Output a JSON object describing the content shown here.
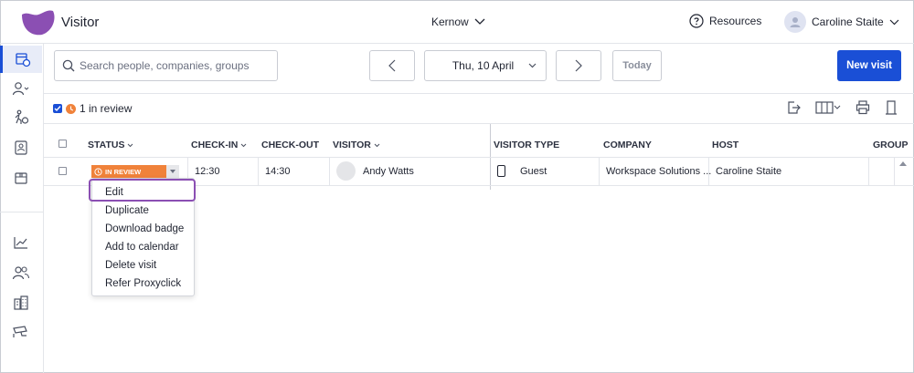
{
  "header": {
    "app_title": "Visitor",
    "location": "Kernow",
    "resources": "Resources",
    "user_name": "Caroline Staite"
  },
  "toolbar": {
    "search_placeholder": "Search people, companies, groups",
    "date": "Thu, 10 April",
    "today": "Today",
    "new_visit": "New visit"
  },
  "filter": {
    "review_label": "1 in review"
  },
  "table": {
    "columns": [
      "STATUS",
      "CHECK-IN",
      "CHECK-OUT",
      "VISITOR",
      "VISITOR TYPE",
      "COMPANY",
      "HOST",
      "GROUP"
    ],
    "rows": [
      {
        "status": "IN REVIEW",
        "check_in": "12:30",
        "check_out": "14:30",
        "visitor": "Andy Watts",
        "visitor_type": "Guest",
        "company": "Workspace Solutions ...",
        "host": "Caroline Staite",
        "group": ""
      }
    ]
  },
  "menu": {
    "items": [
      "Edit",
      "Duplicate",
      "Download badge",
      "Add to calendar",
      "Delete visit",
      "Refer Proxyclick"
    ]
  },
  "colors": {
    "brand_purple": "#8b4fb3",
    "primary_blue": "#1a4fd6",
    "status_orange": "#f0823a"
  }
}
